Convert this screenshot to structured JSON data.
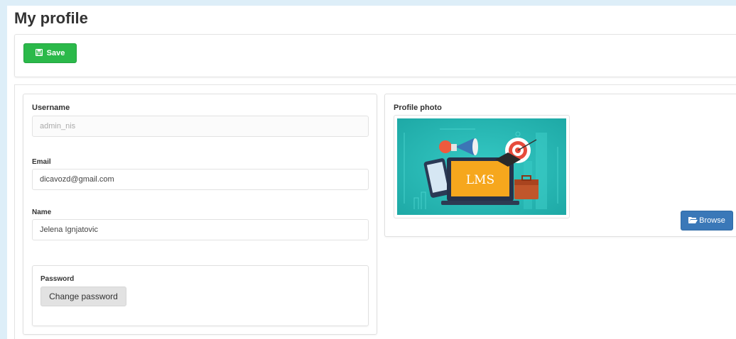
{
  "page": {
    "title": "My profile"
  },
  "toolbar": {
    "save_label": "Save"
  },
  "form": {
    "username": {
      "label": "Username",
      "value": "admin_nis"
    },
    "email": {
      "label": "Email",
      "value": "dicavozd@gmail.com"
    },
    "name": {
      "label": "Name",
      "value": "Jelena Ignjatovic"
    },
    "password": {
      "label": "Password",
      "button_label": "Change password"
    }
  },
  "photo": {
    "label": "Profile photo",
    "image_text": "LMS",
    "browse_label": "Browse"
  },
  "colors": {
    "save": "#2bb94a",
    "browse": "#3a78b8",
    "photo_bg": "#23b7b3",
    "laptop_screen": "#f6a71d"
  },
  "icons": {
    "save": "floppy-disk-icon",
    "browse": "folder-open-icon"
  }
}
